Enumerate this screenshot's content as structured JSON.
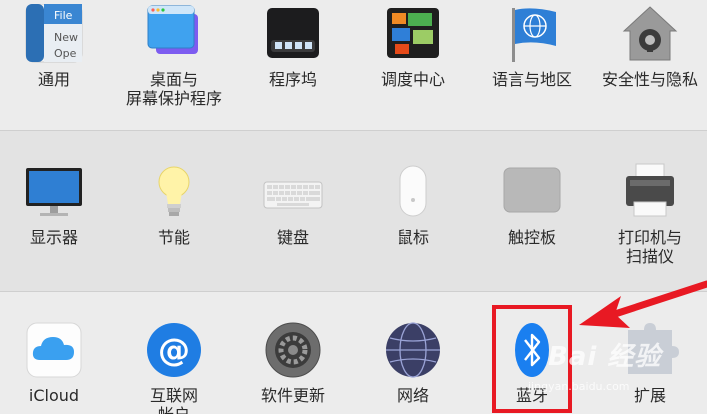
{
  "row1": [
    {
      "id": "general",
      "label": "通用",
      "icon": "general-icon"
    },
    {
      "id": "desktop",
      "label": "桌面与",
      "label2": "屏幕保护程序",
      "icon": "desktop-screensaver-icon"
    },
    {
      "id": "dock",
      "label": "程序坞",
      "icon": "dock-icon"
    },
    {
      "id": "mission",
      "label": "调度中心",
      "icon": "mission-control-icon"
    },
    {
      "id": "language",
      "label": "语言与地区",
      "icon": "language-region-icon"
    },
    {
      "id": "security",
      "label": "安全性与隐私",
      "icon": "security-privacy-icon"
    }
  ],
  "general_icon_text": {
    "line1": "File",
    "line2": "New",
    "line3": "Ope"
  },
  "row2": [
    {
      "id": "displays",
      "label": "显示器",
      "icon": "display-icon"
    },
    {
      "id": "energy",
      "label": "节能",
      "icon": "energy-saver-icon"
    },
    {
      "id": "keyboard",
      "label": "键盘",
      "icon": "keyboard-icon"
    },
    {
      "id": "mouse",
      "label": "鼠标",
      "icon": "mouse-icon"
    },
    {
      "id": "trackpad",
      "label": "触控板",
      "icon": "trackpad-icon"
    },
    {
      "id": "printers",
      "label": "打印机与",
      "label2": "扫描仪",
      "icon": "printer-scanner-icon"
    }
  ],
  "row3": [
    {
      "id": "icloud",
      "label": "iCloud",
      "icon": "icloud-icon"
    },
    {
      "id": "internet",
      "label": "互联网",
      "label2": "帐户",
      "icon": "internet-accounts-icon"
    },
    {
      "id": "update",
      "label": "软件更新",
      "icon": "software-update-icon"
    },
    {
      "id": "network",
      "label": "网络",
      "icon": "network-icon"
    },
    {
      "id": "bluetooth",
      "label": "蓝牙",
      "icon": "bluetooth-icon"
    },
    {
      "id": "extensions",
      "label": "扩展",
      "icon": "extensions-icon"
    }
  ],
  "watermark": {
    "main": "Bai 经验",
    "sub": "jingyan.baidu.com"
  },
  "colors": {
    "highlight": "#e81923",
    "arrow": "#e81923"
  }
}
